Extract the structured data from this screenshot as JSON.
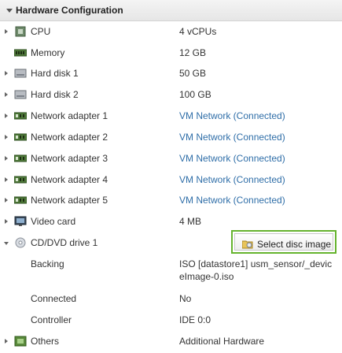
{
  "header": {
    "title": "Hardware Configuration"
  },
  "rows": [
    {
      "label": "CPU",
      "value": "4 vCPUs",
      "icon": "cpu-icon"
    },
    {
      "label": "Memory",
      "value": "12 GB",
      "icon": "memory-icon"
    },
    {
      "label": "Hard disk 1",
      "value": "50 GB",
      "icon": "hard-disk-icon"
    },
    {
      "label": "Hard disk 2",
      "value": "100 GB",
      "icon": "hard-disk-icon"
    },
    {
      "label": "Network adapter 1",
      "value": "VM Network (Connected)",
      "icon": "network-adapter-icon"
    },
    {
      "label": "Network adapter 2",
      "value": "VM Network (Connected)",
      "icon": "network-adapter-icon"
    },
    {
      "label": "Network adapter 3",
      "value": "VM Network (Connected)",
      "icon": "network-adapter-icon"
    },
    {
      "label": "Network adapter 4",
      "value": "VM Network (Connected)",
      "icon": "network-adapter-icon"
    },
    {
      "label": "Network adapter 5",
      "value": "VM Network (Connected)",
      "icon": "network-adapter-icon"
    },
    {
      "label": "Video card",
      "value": "4 MB",
      "icon": "video-card-icon"
    },
    {
      "label": "CD/DVD drive 1",
      "value": "",
      "icon": "cd-dvd-icon"
    },
    {
      "label": "Others",
      "value": "Additional Hardware",
      "icon": "others-icon"
    }
  ],
  "cd_dvd": {
    "button_label": "Select disc image",
    "backing_label": "Backing",
    "backing_value": "ISO [datastore1] usm_sensor/_deviceImage-0.iso",
    "backing_line1": "ISO [datastore1] usm_sensor/_devic",
    "backing_line2": "eImage-0.iso",
    "connected_label": "Connected",
    "connected_value": "No",
    "controller_label": "Controller",
    "controller_value": "IDE 0:0"
  },
  "colors": {
    "link": "#2f6ea8",
    "highlight": "#65b32e",
    "header_bg": "#eeeeee"
  }
}
